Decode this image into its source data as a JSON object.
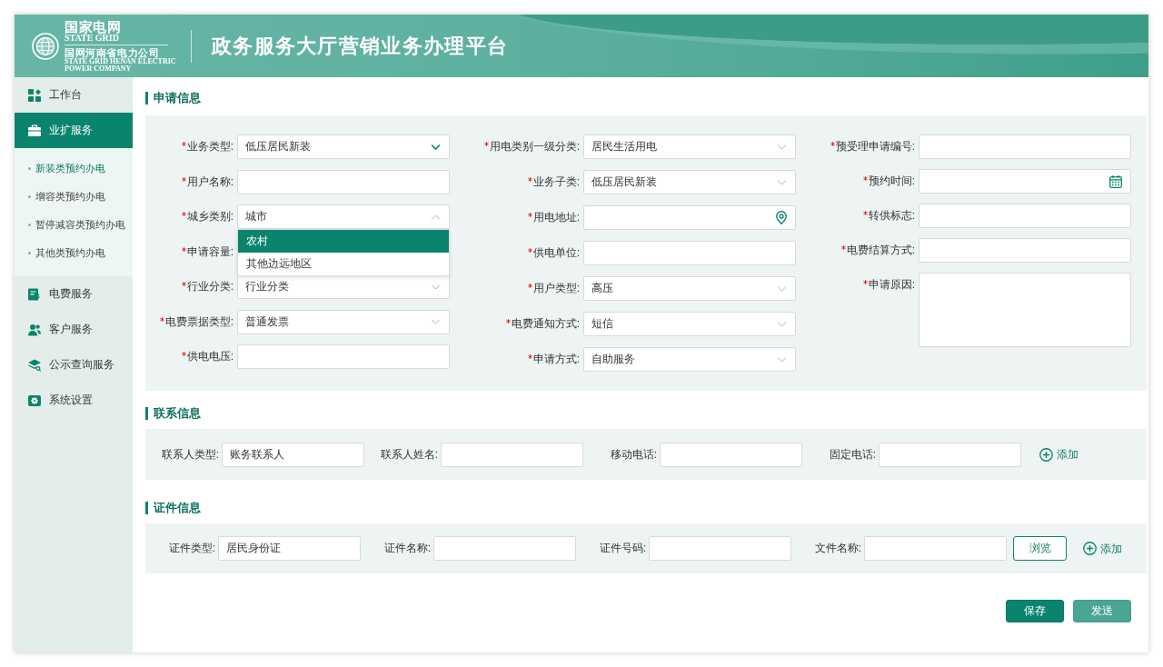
{
  "header": {
    "logo": {
      "name": "国家电网",
      "name_en": "STATE GRID",
      "company": "国网河南省电力公司",
      "company_en": "STATE GRID HENAN ELECTRIC POWER COMPANY"
    },
    "title": "政务服务大厅营销业务办理平台"
  },
  "sidebar": {
    "items": [
      {
        "label": "工作台",
        "selected": false
      },
      {
        "label": "业扩服务",
        "selected": true,
        "children": [
          {
            "label": "新装类预约办电",
            "selected": true
          },
          {
            "label": "增容类预约办电",
            "selected": false
          },
          {
            "label": "暂停减容类预约办电",
            "selected": false
          },
          {
            "label": "其他类预约办电",
            "selected": false
          }
        ]
      },
      {
        "label": "电费服务",
        "selected": false
      },
      {
        "label": "客户服务",
        "selected": false
      },
      {
        "label": "公示查询服务",
        "selected": false
      },
      {
        "label": "系统设置",
        "selected": false
      }
    ]
  },
  "application": {
    "title": "申请信息",
    "columns": [
      [
        {
          "label": "业务类型:",
          "required": true,
          "field": {
            "kind": "select",
            "value": "低压居民新装",
            "open": false,
            "focused": true
          }
        },
        {
          "label": "用户名称:",
          "required": true,
          "field": {
            "kind": "text"
          }
        },
        {
          "label": "城乡类别:",
          "required": true,
          "field": {
            "kind": "select",
            "value": "城市",
            "open": true,
            "focused": false,
            "options": [
              {
                "label": "农村",
                "selected": true
              },
              {
                "label": "其他边远地区",
                "selected": false
              }
            ]
          }
        },
        {
          "label": "申请容量:",
          "required": true
        },
        {
          "label": "行业分类:",
          "required": true,
          "field": {
            "kind": "select",
            "value": "行业分类",
            "open": false,
            "focused": false
          }
        },
        {
          "label": "电费票据类型:",
          "required": true,
          "field": {
            "kind": "select",
            "value": "普通发票",
            "open": false,
            "focused": false
          }
        },
        {
          "label": "供电电压:",
          "required": true,
          "field": {
            "kind": "text"
          }
        }
      ],
      [
        {
          "label": "用电类别一级分类:",
          "required": true,
          "field": {
            "kind": "select",
            "value": "居民生活用电",
            "open": false,
            "focused": false
          }
        },
        {
          "label": "业务子类:",
          "required": true,
          "field": {
            "kind": "select",
            "value": "低压居民新装",
            "open": false,
            "focused": false
          }
        },
        {
          "label": "用电地址:",
          "required": true,
          "field": {
            "kind": "address"
          }
        },
        {
          "label": "供电单位:",
          "required": true,
          "field": {
            "kind": "text"
          }
        },
        {
          "label": "用户类型:",
          "required": true,
          "field": {
            "kind": "select",
            "value": "高压",
            "open": false,
            "focused": false
          }
        },
        {
          "label": "电费通知方式:",
          "required": true,
          "field": {
            "kind": "select",
            "value": "短信",
            "open": false,
            "focused": false
          }
        },
        {
          "label": "申请方式:",
          "required": true,
          "field": {
            "kind": "select",
            "value": "自助服务",
            "open": false,
            "focused": false
          }
        }
      ],
      [
        {
          "label": "预受理申请编号:",
          "required": true,
          "field": {
            "kind": "text"
          }
        },
        {
          "label": "预约时间:",
          "required": true,
          "field": {
            "kind": "date"
          }
        },
        {
          "label": "转供标志:",
          "required": true,
          "field": {
            "kind": "text"
          }
        },
        {
          "label": "电费结算方式:",
          "required": true,
          "field": {
            "kind": "text"
          }
        },
        {
          "label": "申请原因:",
          "required": true,
          "field": {
            "kind": "textarea"
          }
        }
      ]
    ]
  },
  "contact": {
    "title": "联系信息",
    "fields": [
      {
        "label": "联系人类型:",
        "value": "账务联系人"
      },
      {
        "label": "联系人姓名:"
      },
      {
        "label": "移动电话:"
      },
      {
        "label": "固定电话:"
      }
    ],
    "actions": [
      {
        "kind": "add",
        "label": "添加"
      }
    ]
  },
  "certificate": {
    "title": "证件信息",
    "fields": [
      {
        "label": "证件类型:",
        "value": "居民身份证"
      },
      {
        "label": "证件名称:"
      },
      {
        "label": "证件号码:"
      },
      {
        "label": "文件名称:"
      }
    ],
    "actions": [
      {
        "kind": "browse",
        "label": "浏览"
      },
      {
        "kind": "add",
        "label": "添加"
      }
    ]
  },
  "buttons": [
    {
      "label": "保存",
      "kind": "primary"
    },
    {
      "label": "发送",
      "kind": "secondary"
    }
  ]
}
